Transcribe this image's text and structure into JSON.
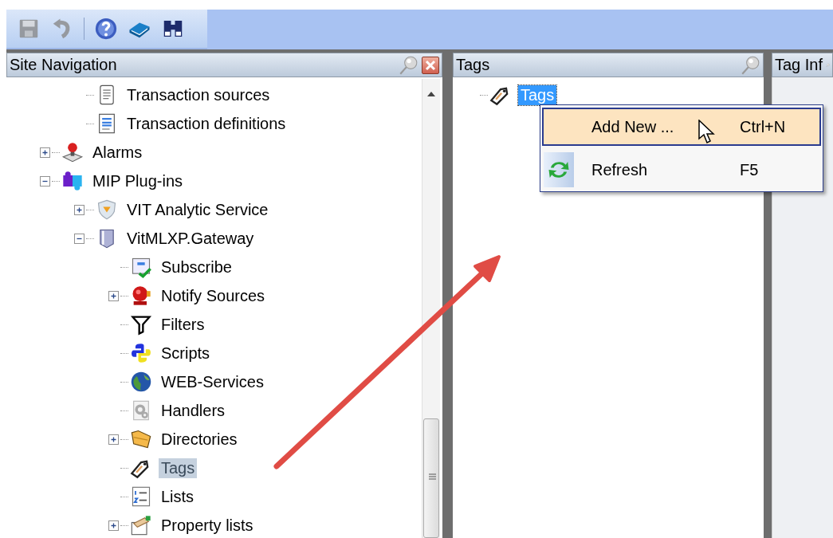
{
  "toolbar": {
    "buttons": [
      {
        "kind": "save",
        "disabled": true
      },
      {
        "kind": "undo",
        "disabled": true
      },
      {
        "kind": "separator"
      },
      {
        "kind": "help",
        "disabled": false
      },
      {
        "kind": "book",
        "disabled": false
      },
      {
        "kind": "binoculars",
        "disabled": false
      }
    ]
  },
  "panels": [
    {
      "title": "Site Navigation",
      "closable": true,
      "focused": false,
      "scrollbar": true,
      "tree": [
        {
          "children": [
            {
              "label": "Transaction sources",
              "kind": "document",
              "selected": false
            },
            {
              "label": "Transaction definitions",
              "kind": "form",
              "selected": false
            }
          ]
        },
        {
          "label": "Alarms",
          "kind": "alarm",
          "expanded": false,
          "selected": false
        },
        {
          "label": "MIP Plug-ins",
          "kind": "puzzle",
          "expanded": true,
          "selected": false,
          "children": [
            {
              "label": "VIT Analytic Service",
              "kind": "shield",
              "expanded": false,
              "selected": false
            },
            {
              "label": "VitMLXP.Gateway",
              "kind": "gateway",
              "expanded": true,
              "selected": false,
              "children": [
                {
                  "label": "Subscribe",
                  "kind": "subscribe",
                  "selected": false
                },
                {
                  "label": "Notify Sources",
                  "kind": "siren",
                  "expanded": false,
                  "selected": false
                },
                {
                  "label": "Filters",
                  "kind": "funnel",
                  "selected": false
                },
                {
                  "label": "Scripts",
                  "kind": "script",
                  "selected": false
                },
                {
                  "label": "WEB-Services",
                  "kind": "globe",
                  "selected": false
                },
                {
                  "label": "Handlers",
                  "kind": "gear",
                  "selected": false
                },
                {
                  "label": "Directories",
                  "kind": "folder",
                  "expanded": false,
                  "selected": false
                },
                {
                  "label": "Tags",
                  "kind": "tag",
                  "selected": true
                },
                {
                  "label": "Lists",
                  "kind": "numbered",
                  "selected": false
                },
                {
                  "label": "Property lists",
                  "kind": "card",
                  "expanded": false,
                  "selected": false
                }
              ]
            }
          ]
        }
      ]
    },
    {
      "title": "Tags",
      "focused": true,
      "tree": [
        {
          "label": "Tags",
          "kind": "tag",
          "selected": true
        }
      ]
    },
    {
      "title": "Tag Inf"
    }
  ],
  "context_menu": {
    "items": [
      {
        "label": "Add New ...",
        "shortcut": "Ctrl+N",
        "kind": "plain",
        "selected": true
      },
      {
        "label": "Refresh",
        "shortcut": "F5",
        "kind": "refresh",
        "selected": false
      }
    ]
  }
}
